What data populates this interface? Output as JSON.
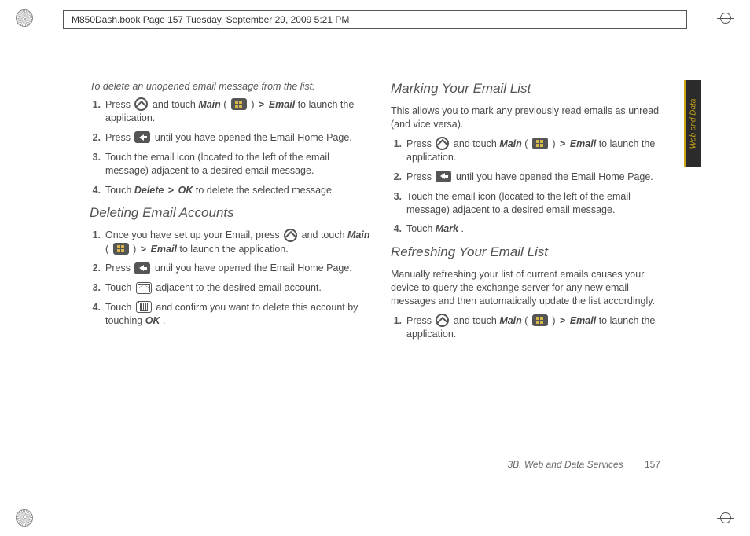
{
  "crop": {
    "header_text": "M850Dash.book  Page 157  Tuesday, September 29, 2009  5:21 PM"
  },
  "sidetab": {
    "label": "Web and Data"
  },
  "footer": {
    "section": "3B. Web and Data Services",
    "page": "157"
  },
  "left": {
    "lead": "To delete an unopened email message from the list:",
    "s1": {
      "a": "Press ",
      "b": " and touch ",
      "main": "Main",
      "c": " ( ",
      "d": " ) ",
      "gt": ">",
      "email": "Email",
      "e": " to launch the application."
    },
    "s2": {
      "a": "Press ",
      "b": " until you have opened the Email Home Page."
    },
    "s3": "Touch the email icon (located to the left of the email message) adjacent to a desired email message.",
    "s4": {
      "a": "Touch ",
      "del": "Delete",
      "gt": ">",
      "ok": "OK",
      "b": " to delete the selected message."
    },
    "h_delacc": "Deleting Email Accounts",
    "da1": {
      "a": "Once you have set up your Email, press ",
      "b": " and touch ",
      "main": "Main",
      "c": " ( ",
      "d": " ) ",
      "gt": ">",
      "email": "Email",
      "e": " to launch the application."
    },
    "da2": {
      "a": "Press ",
      "b": " until you have opened the Email Home Page."
    },
    "da3": {
      "a": "Touch ",
      "b": " adjacent to the desired email account."
    },
    "da4": {
      "a": "Touch ",
      "b": " and confirm you want to delete this account by touching ",
      "ok": "OK",
      "c": "."
    }
  },
  "right": {
    "h_mark": "Marking Your Email List",
    "mark_intro": "This allows you to mark any previously read emails as unread (and vice versa).",
    "m1": {
      "a": "Press ",
      "b": " and touch ",
      "main": "Main",
      "c": " ( ",
      "d": " ) ",
      "gt": ">",
      "email": "Email",
      "e": " to launch the application."
    },
    "m2": {
      "a": "Press ",
      "b": " until you have opened the Email Home Page."
    },
    "m3": "Touch the email icon (located to the left of the email message) adjacent to a desired email message.",
    "m4": {
      "a": "Touch ",
      "mark": "Mark",
      "b": "."
    },
    "h_refresh": "Refreshing Your Email List",
    "refresh_intro": "Manually refreshing your list of current emails causes your device to query the exchange server for any new email messages and then automatically update the list accordingly.",
    "r1": {
      "a": "Press ",
      "b": " and touch ",
      "main": "Main",
      "c": " ( ",
      "d": " ) ",
      "gt": ">",
      "email": "Email",
      "e": " to launch the application."
    }
  }
}
